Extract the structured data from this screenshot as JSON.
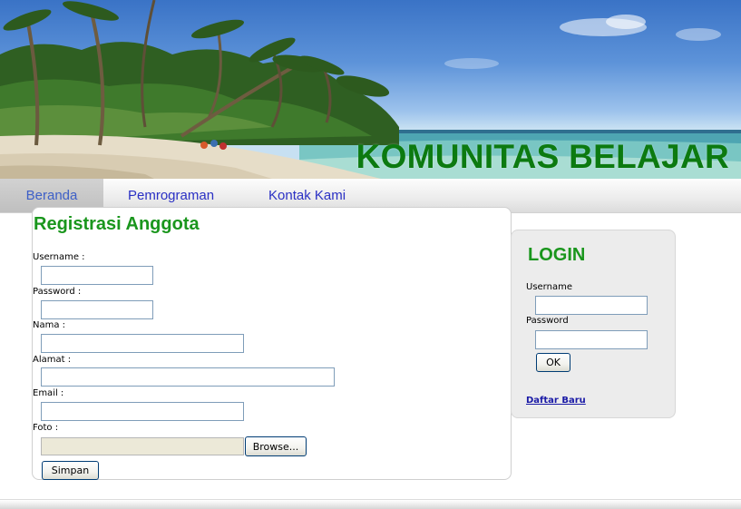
{
  "header": {
    "site_title": "KOMUNITAS BELAJAR",
    "title_color": "#0c7a10"
  },
  "nav": {
    "items": [
      {
        "label": "Beranda",
        "active": true
      },
      {
        "label": "Pemrograman",
        "active": false
      },
      {
        "label": "Kontak Kami",
        "active": false
      }
    ],
    "link_color": "#2a30c4"
  },
  "registration": {
    "title": "Registrasi Anggota",
    "title_color": "#1a961d",
    "fields": {
      "username": {
        "label": "Username :",
        "value": ""
      },
      "password": {
        "label": "Password :",
        "value": ""
      },
      "nama": {
        "label": "Nama :",
        "value": ""
      },
      "alamat": {
        "label": "Alamat :",
        "value": ""
      },
      "email": {
        "label": "Email :",
        "value": ""
      },
      "foto": {
        "label": "Foto :",
        "value": ""
      }
    },
    "browse_label": "Browse...",
    "submit_label": "Simpan"
  },
  "login": {
    "title": "LOGIN",
    "username_label": "Username",
    "password_label": "Password",
    "username_value": "",
    "password_value": "",
    "submit_label": "OK",
    "register_link": "Daftar Baru"
  }
}
